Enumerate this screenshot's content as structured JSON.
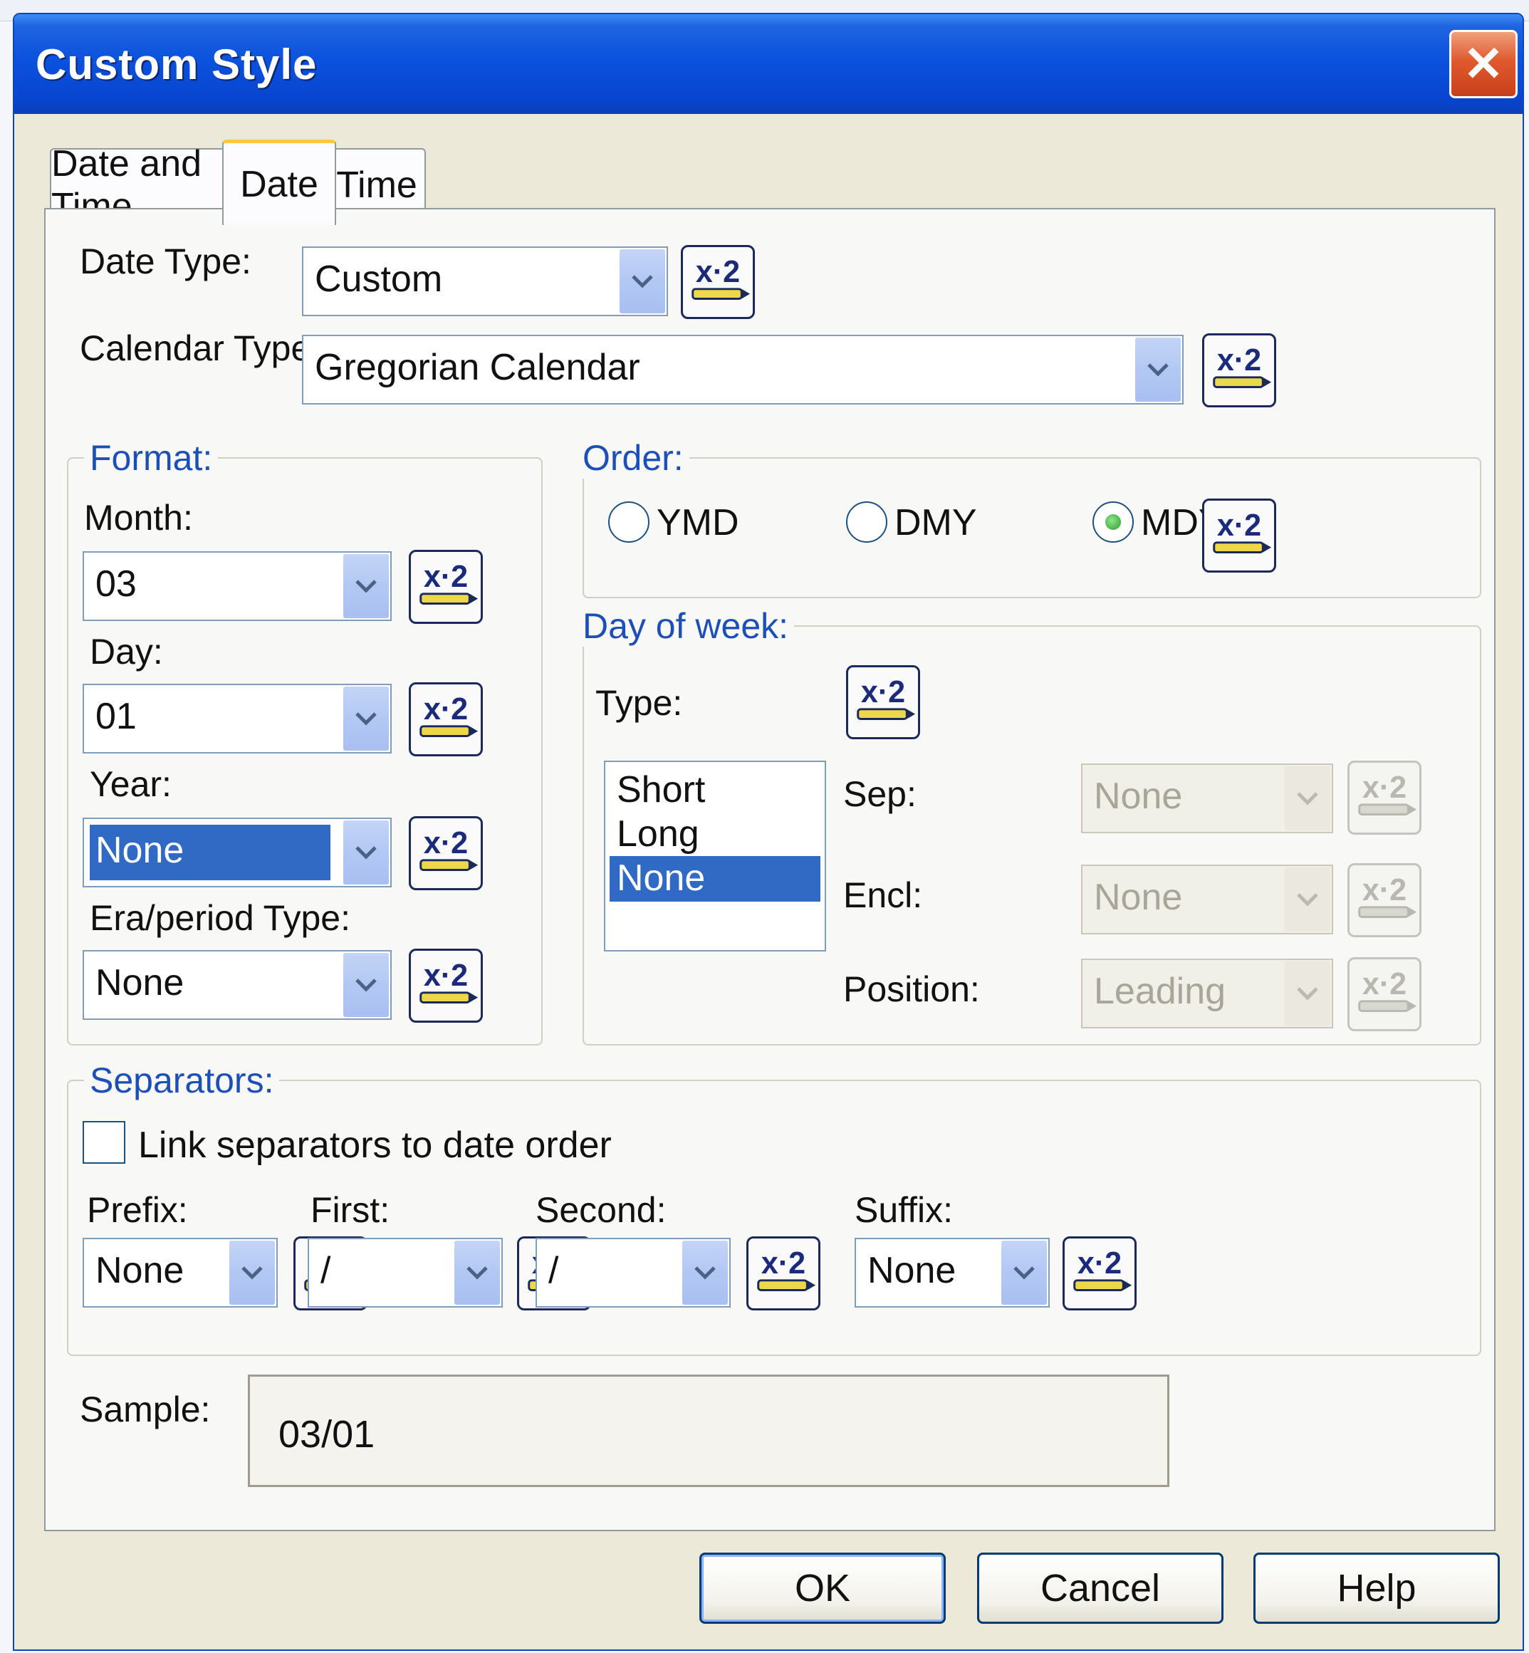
{
  "window": {
    "title": "Custom Style",
    "close_glyph": "✕"
  },
  "tabs": [
    {
      "label": "Date and Time",
      "active": false
    },
    {
      "label": "Date",
      "active": true
    },
    {
      "label": "Time",
      "active": false
    }
  ],
  "date_type": {
    "label": "Date Type:",
    "value": "Custom"
  },
  "calendar_type": {
    "label": "Calendar Type:",
    "value": "Gregorian Calendar"
  },
  "format": {
    "legend": "Format:",
    "month": {
      "label": "Month:",
      "value": "03"
    },
    "day": {
      "label": "Day:",
      "value": "01"
    },
    "year": {
      "label": "Year:",
      "value": "None"
    },
    "era": {
      "label": "Era/period Type:",
      "value": "None"
    }
  },
  "order": {
    "legend": "Order:",
    "options": [
      {
        "label": "YMD",
        "selected": false
      },
      {
        "label": "DMY",
        "selected": false
      },
      {
        "label": "MDY",
        "selected": true
      }
    ]
  },
  "day_of_week": {
    "legend": "Day of week:",
    "type_label": "Type:",
    "type_options": [
      "Short",
      "Long",
      "None"
    ],
    "selected_type": "None",
    "sep": {
      "label": "Sep:",
      "value": "None"
    },
    "encl": {
      "label": "Encl:",
      "value": "None"
    },
    "position": {
      "label": "Position:",
      "value": "Leading"
    }
  },
  "separators": {
    "legend": "Separators:",
    "link_label": "Link separators to date order",
    "link_checked": false,
    "prefix": {
      "label": "Prefix:",
      "value": "None"
    },
    "first": {
      "label": "First:",
      "value": "/"
    },
    "second": {
      "label": "Second:",
      "value": "/"
    },
    "suffix": {
      "label": "Suffix:",
      "value": "None"
    }
  },
  "sample": {
    "label": "Sample:",
    "value": "03/01"
  },
  "buttons": {
    "ok": "OK",
    "cancel": "Cancel",
    "help": "Help"
  },
  "icons": {
    "expression_button": "x2-expression-icon",
    "dropdown": "chevron-down-icon"
  },
  "colors": {
    "titlebar": "#0b52de",
    "selection": "#316ac5",
    "group_legend": "#1d4fb8",
    "dialog_face": "#ece9d8"
  }
}
